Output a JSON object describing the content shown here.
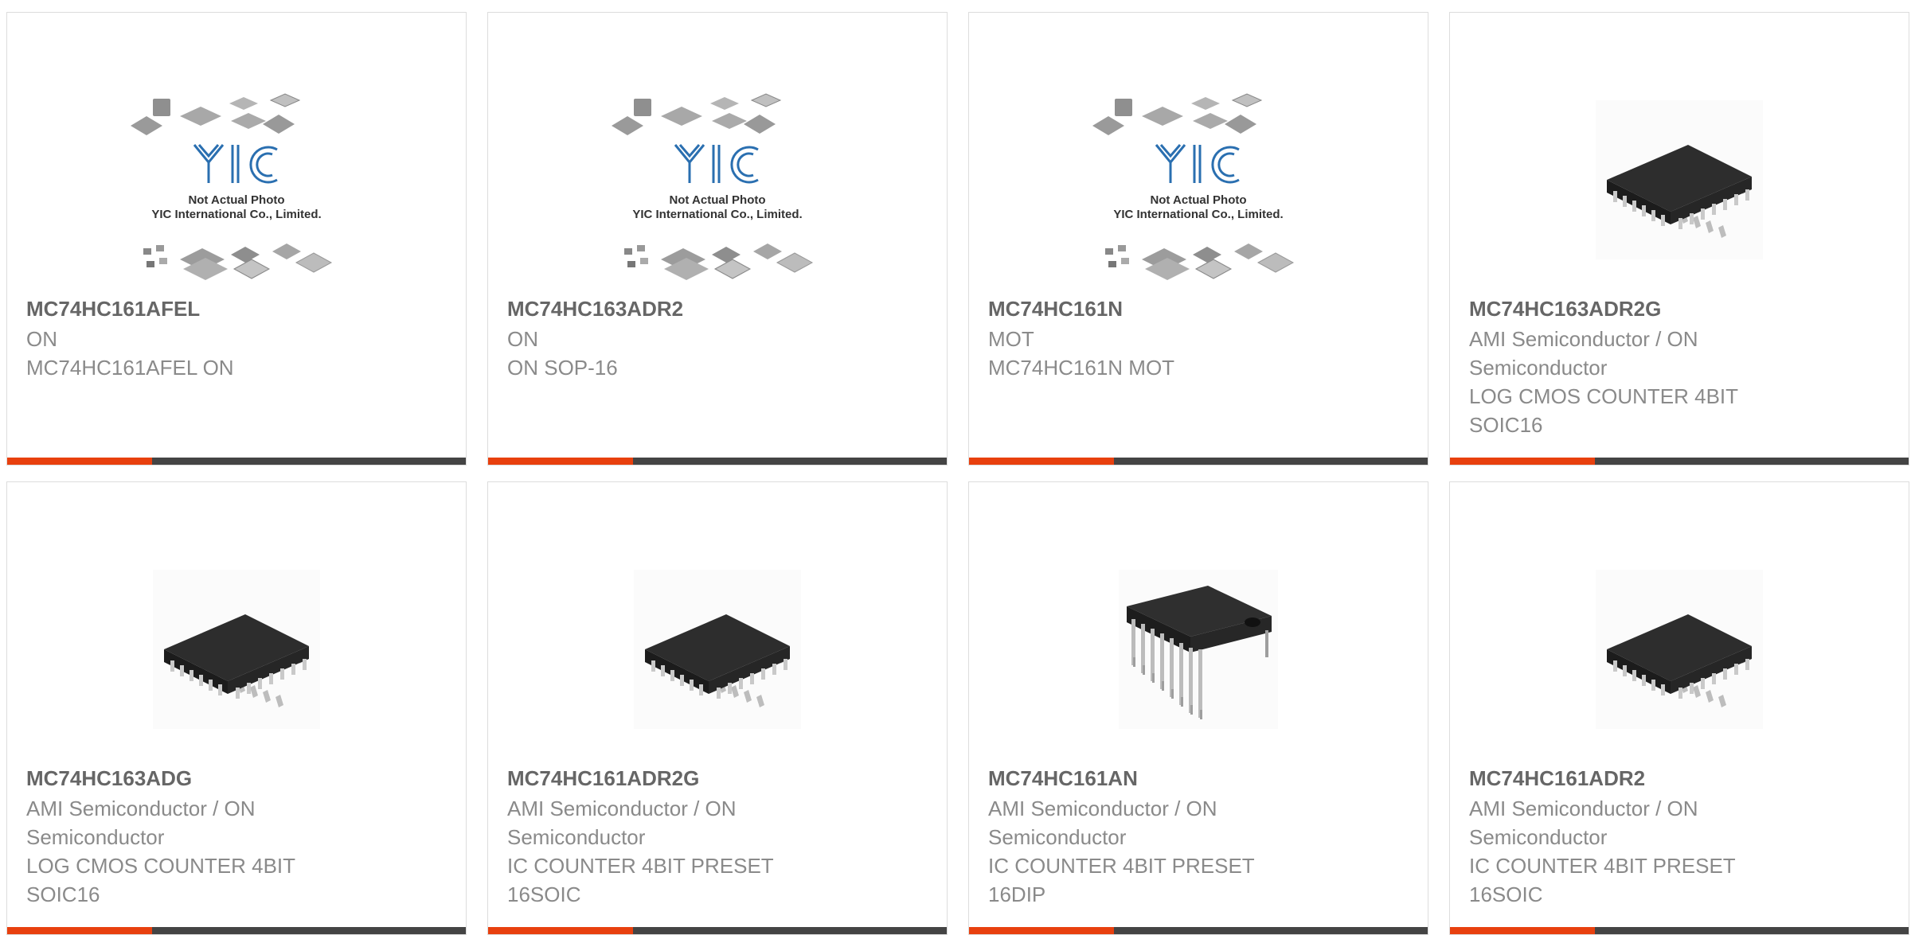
{
  "products": [
    {
      "part_number": "MC74HC161AFEL",
      "lines": [
        "ON",
        "MC74HC161AFEL ON"
      ],
      "image": "placeholder-collage-icon",
      "placeholder_caption": [
        "Not Actual Photo",
        "YIC International Co., Limited."
      ],
      "placeholder_logo_text": "YIC"
    },
    {
      "part_number": "MC74HC163ADR2",
      "lines": [
        "ON",
        "ON SOP-16"
      ],
      "image": "placeholder-collage-icon",
      "placeholder_caption": [
        "Not Actual Photo",
        "YIC International Co., Limited."
      ],
      "placeholder_logo_text": "YIC"
    },
    {
      "part_number": "MC74HC161N",
      "lines": [
        "MOT",
        "MC74HC161N MOT"
      ],
      "image": "placeholder-collage-icon",
      "placeholder_caption": [
        "Not Actual Photo",
        "YIC International Co., Limited."
      ],
      "placeholder_logo_text": "YIC"
    },
    {
      "part_number": "MC74HC163ADR2G",
      "lines": [
        "AMI Semiconductor / ON",
        "Semiconductor",
        "LOG CMOS COUNTER 4BIT",
        "SOIC16"
      ],
      "image": "soic-chip-icon"
    },
    {
      "part_number": "MC74HC163ADG",
      "lines": [
        "AMI Semiconductor / ON",
        "Semiconductor",
        "LOG CMOS COUNTER 4BIT",
        "SOIC16"
      ],
      "image": "soic-chip-icon"
    },
    {
      "part_number": "MC74HC161ADR2G",
      "lines": [
        "AMI Semiconductor / ON",
        "Semiconductor",
        "IC COUNTER 4BIT PRESET",
        "16SOIC"
      ],
      "image": "soic-chip-icon"
    },
    {
      "part_number": "MC74HC161AN",
      "lines": [
        "AMI Semiconductor / ON",
        "Semiconductor",
        "IC COUNTER 4BIT PRESET",
        "16DIP"
      ],
      "image": "dip-chip-icon"
    },
    {
      "part_number": "MC74HC161ADR2",
      "lines": [
        "AMI Semiconductor / ON",
        "Semiconductor",
        "IC COUNTER 4BIT PRESET",
        "16SOIC"
      ],
      "image": "soic-chip-icon"
    }
  ],
  "colors": {
    "accent_orange": "#e8400e",
    "accent_dark": "#444444",
    "title_text": "#666666",
    "body_text": "#8a8a8a",
    "border": "#dddddd"
  }
}
